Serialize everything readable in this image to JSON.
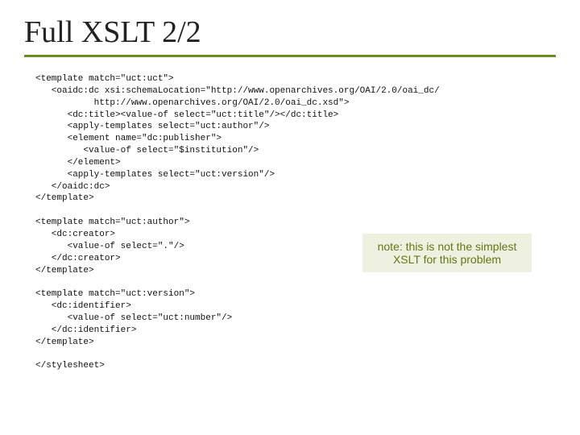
{
  "title": "Full XSLT 2/2",
  "code": {
    "l1": "<template match=\"uct:uct\">",
    "l2": "   <oaidc:dc xsi:schemaLocation=\"http://www.openarchives.org/OAI/2.0/oai_dc/",
    "l3": "           http://www.openarchives.org/OAI/2.0/oai_dc.xsd\">",
    "l4": "      <dc:title><value-of select=\"uct:title\"/></dc:title>",
    "l5": "      <apply-templates select=\"uct:author\"/>",
    "l6": "      <element name=\"dc:publisher\">",
    "l7": "         <value-of select=\"$institution\"/>",
    "l8": "      </element>",
    "l9": "      <apply-templates select=\"uct:version\"/>",
    "l10": "   </oaidc:dc>",
    "l11": "</template>",
    "l12": "",
    "l13": "<template match=\"uct:author\">",
    "l14": "   <dc:creator>",
    "l15": "      <value-of select=\".\"/>",
    "l16": "   </dc:creator>",
    "l17": "</template>",
    "l18": "",
    "l19": "<template match=\"uct:version\">",
    "l20": "   <dc:identifier>",
    "l21": "      <value-of select=\"uct:number\"/>",
    "l22": "   </dc:identifier>",
    "l23": "</template>",
    "l24": "",
    "l25": "</stylesheet>"
  },
  "note": "note: this is not the simplest XSLT for this problem"
}
